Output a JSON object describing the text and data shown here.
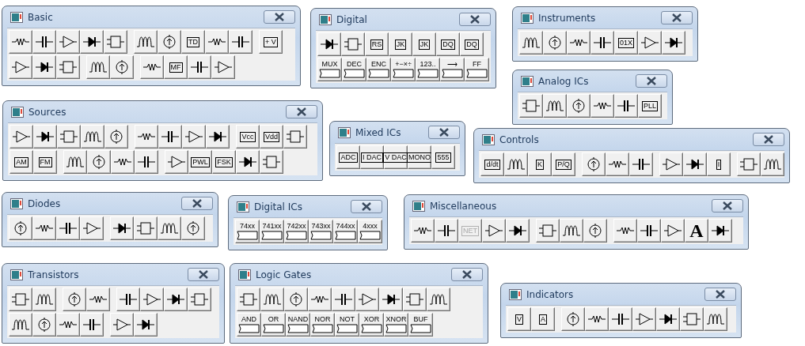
{
  "palettes": [
    {
      "title": "Basic",
      "rows": [
        [
          [
            {
              "kind": "symbol"
            },
            {
              "kind": "symbol"
            },
            {
              "kind": "symbol"
            },
            {
              "kind": "symbol"
            },
            {
              "kind": "symbol"
            }
          ],
          [
            {
              "kind": "symbol"
            },
            {
              "kind": "symbol"
            },
            {
              "kind": "tag",
              "label": "TD"
            },
            {
              "kind": "symbol"
            },
            {
              "kind": "symbol"
            }
          ],
          [
            {
              "kind": "tag",
              "label": "+ V"
            }
          ]
        ],
        [
          [
            {
              "kind": "symbol"
            },
            {
              "kind": "symbol"
            },
            {
              "kind": "symbol"
            }
          ],
          [
            {
              "kind": "symbol"
            },
            {
              "kind": "symbol"
            }
          ],
          [
            {
              "kind": "symbol"
            },
            {
              "kind": "tag",
              "label": "MF"
            },
            {
              "kind": "symbol"
            },
            {
              "kind": "symbol"
            }
          ]
        ]
      ]
    },
    {
      "title": "Digital",
      "rows": [
        [
          [
            {
              "kind": "symbol"
            },
            {
              "kind": "symbol"
            },
            {
              "kind": "tag",
              "label": "RS"
            },
            {
              "kind": "tag",
              "label": "JK"
            },
            {
              "kind": "tag",
              "label": "JK"
            },
            {
              "kind": "tag",
              "label": "DQ"
            },
            {
              "kind": "tag",
              "label": "DQ"
            }
          ]
        ],
        [
          [
            {
              "kind": "chip",
              "label": "MUX"
            },
            {
              "kind": "chip",
              "label": "DEC"
            },
            {
              "kind": "chip",
              "label": "ENC"
            },
            {
              "kind": "chip",
              "label": "+−×÷"
            },
            {
              "kind": "chip",
              "label": "123.."
            },
            {
              "kind": "chip",
              "label": "⟶"
            },
            {
              "kind": "chip",
              "label": "FF"
            }
          ]
        ]
      ]
    },
    {
      "title": "Instruments",
      "rows": [
        [
          [
            {
              "kind": "symbol"
            },
            {
              "kind": "symbol"
            },
            {
              "kind": "symbol"
            },
            {
              "kind": "symbol"
            },
            {
              "kind": "tag",
              "label": "01X"
            },
            {
              "kind": "symbol"
            },
            {
              "kind": "symbol"
            }
          ]
        ]
      ]
    },
    {
      "title": "Analog ICs",
      "rows": [
        [
          [
            {
              "kind": "symbol"
            },
            {
              "kind": "symbol"
            },
            {
              "kind": "symbol"
            },
            {
              "kind": "symbol"
            },
            {
              "kind": "symbol"
            },
            {
              "kind": "tag",
              "label": "PLL"
            }
          ]
        ]
      ]
    },
    {
      "title": "Sources",
      "rows": [
        [
          [
            {
              "kind": "symbol"
            },
            {
              "kind": "symbol"
            },
            {
              "kind": "symbol"
            },
            {
              "kind": "symbol"
            },
            {
              "kind": "symbol"
            }
          ],
          [
            {
              "kind": "symbol"
            },
            {
              "kind": "symbol"
            },
            {
              "kind": "symbol"
            },
            {
              "kind": "symbol"
            }
          ],
          [
            {
              "kind": "tag",
              "label": "Vcc"
            },
            {
              "kind": "tag",
              "label": "Vdd"
            },
            {
              "kind": "symbol"
            }
          ]
        ],
        [
          [
            {
              "kind": "tag",
              "label": "AM"
            },
            {
              "kind": "tag",
              "label": "FM"
            }
          ],
          [
            {
              "kind": "symbol"
            },
            {
              "kind": "symbol"
            },
            {
              "kind": "symbol"
            },
            {
              "kind": "symbol"
            }
          ],
          [
            {
              "kind": "symbol"
            },
            {
              "kind": "tag",
              "label": "PWL"
            },
            {
              "kind": "tag",
              "label": "FSK"
            },
            {
              "kind": "symbol"
            },
            {
              "kind": "symbol"
            }
          ]
        ]
      ]
    },
    {
      "title": "Mixed ICs",
      "rows": [
        [
          [
            {
              "kind": "tag",
              "label": "ADC"
            },
            {
              "kind": "tag",
              "label": "I DAC"
            },
            {
              "kind": "tag",
              "label": "V DAC"
            },
            {
              "kind": "tag",
              "label": "MONO"
            },
            {
              "kind": "tag",
              "label": "555"
            }
          ]
        ]
      ]
    },
    {
      "title": "Controls",
      "rows": [
        [
          [
            {
              "kind": "tag",
              "label": "d/dt"
            },
            {
              "kind": "symbol"
            },
            {
              "kind": "tag",
              "label": "K"
            },
            {
              "kind": "tag",
              "label": "P/Q"
            }
          ],
          [
            {
              "kind": "symbol"
            },
            {
              "kind": "symbol"
            },
            {
              "kind": "symbol"
            }
          ],
          [
            {
              "kind": "symbol"
            },
            {
              "kind": "symbol"
            },
            {
              "kind": "tag",
              "label": "I"
            }
          ],
          [
            {
              "kind": "symbol"
            },
            {
              "kind": "symbol"
            }
          ]
        ]
      ]
    },
    {
      "title": "Diodes",
      "rows": [
        [
          [
            {
              "kind": "symbol"
            },
            {
              "kind": "symbol"
            },
            {
              "kind": "symbol"
            },
            {
              "kind": "symbol"
            }
          ],
          [
            {
              "kind": "symbol"
            },
            {
              "kind": "symbol"
            },
            {
              "kind": "symbol"
            },
            {
              "kind": "symbol"
            }
          ]
        ]
      ]
    },
    {
      "title": "Digital ICs",
      "rows": [
        [
          [
            {
              "kind": "chip",
              "label": "74xx"
            },
            {
              "kind": "chip",
              "label": "741xx"
            },
            {
              "kind": "chip",
              "label": "742xx"
            },
            {
              "kind": "chip",
              "label": "743xx"
            },
            {
              "kind": "chip",
              "label": "744xx"
            },
            {
              "kind": "chip",
              "label": "4xxx"
            }
          ]
        ]
      ]
    },
    {
      "title": "Miscellaneous",
      "rows": [
        [
          [
            {
              "kind": "symbol",
              "disabled": false
            },
            {
              "kind": "symbol",
              "disabled": false
            },
            {
              "kind": "tag",
              "label": "NET",
              "disabled": true
            },
            {
              "kind": "symbol",
              "disabled": false
            },
            {
              "kind": "symbol",
              "disabled": false
            }
          ],
          [
            {
              "kind": "symbol",
              "disabled": false
            },
            {
              "kind": "symbol",
              "disabled": false
            },
            {
              "kind": "symbol",
              "disabled": false
            }
          ],
          [
            {
              "kind": "symbol",
              "disabled": false
            },
            {
              "kind": "symbol",
              "disabled": false
            },
            {
              "kind": "symbol",
              "disabled": false
            },
            {
              "kind": "letter",
              "label": "A",
              "disabled": false
            },
            {
              "kind": "symbol",
              "disabled": false
            }
          ]
        ]
      ]
    },
    {
      "title": "Transistors",
      "rows": [
        [
          [
            {
              "kind": "symbol"
            },
            {
              "kind": "symbol"
            }
          ],
          [
            {
              "kind": "symbol"
            },
            {
              "kind": "symbol"
            }
          ],
          [
            {
              "kind": "symbol"
            },
            {
              "kind": "symbol"
            },
            {
              "kind": "symbol"
            },
            {
              "kind": "symbol"
            }
          ]
        ],
        [
          [
            {
              "kind": "symbol"
            },
            {
              "kind": "symbol"
            },
            {
              "kind": "symbol"
            },
            {
              "kind": "symbol"
            }
          ],
          [
            {
              "kind": "symbol"
            },
            {
              "kind": "symbol"
            }
          ]
        ]
      ]
    },
    {
      "title": "Logic Gates",
      "rows": [
        [
          [
            {
              "kind": "symbol"
            },
            {
              "kind": "symbol"
            },
            {
              "kind": "symbol"
            },
            {
              "kind": "symbol"
            },
            {
              "kind": "symbol"
            },
            {
              "kind": "symbol"
            },
            {
              "kind": "symbol"
            },
            {
              "kind": "symbol"
            },
            {
              "kind": "symbol"
            }
          ]
        ],
        [
          [
            {
              "kind": "chip",
              "label": "AND"
            },
            {
              "kind": "chip",
              "label": "OR"
            },
            {
              "kind": "chip",
              "label": "NAND"
            },
            {
              "kind": "chip",
              "label": "NOR"
            },
            {
              "kind": "chip",
              "label": "NOT"
            },
            {
              "kind": "chip",
              "label": "XOR"
            },
            {
              "kind": "chip",
              "label": "XNOR"
            },
            {
              "kind": "chip",
              "label": "BUF"
            }
          ]
        ]
      ]
    },
    {
      "title": "Indicators",
      "rows": [
        [
          [
            {
              "kind": "tag",
              "label": "V"
            },
            {
              "kind": "tag",
              "label": "A"
            }
          ],
          [
            {
              "kind": "symbol"
            },
            {
              "kind": "symbol"
            },
            {
              "kind": "symbol"
            },
            {
              "kind": "symbol"
            },
            {
              "kind": "symbol"
            },
            {
              "kind": "symbol"
            },
            {
              "kind": "symbol"
            }
          ]
        ]
      ]
    }
  ]
}
